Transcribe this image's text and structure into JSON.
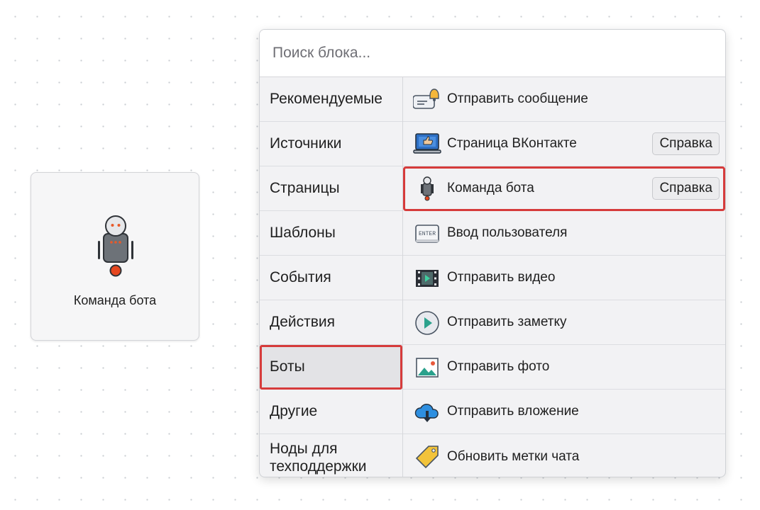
{
  "canvas_node": {
    "label": "Команда бота",
    "icon": "robot-icon"
  },
  "search": {
    "placeholder": "Поиск блока..."
  },
  "categories": [
    {
      "label": "Рекомендуемые"
    },
    {
      "label": "Источники"
    },
    {
      "label": "Страницы"
    },
    {
      "label": "Шаблоны"
    },
    {
      "label": "События"
    },
    {
      "label": "Действия"
    },
    {
      "label": "Боты",
      "selected": true
    },
    {
      "label": "Другие"
    },
    {
      "label": "Ноды для техподдержки"
    }
  ],
  "blocks": [
    {
      "label": "Отправить сообщение",
      "icon": "message-bell-icon"
    },
    {
      "label": "Страница ВКонтакте",
      "icon": "laptop-like-icon",
      "help": "Справка"
    },
    {
      "label": "Команда бота",
      "icon": "robot-icon",
      "help": "Справка",
      "highlighted": true
    },
    {
      "label": "Ввод пользователя",
      "icon": "enter-key-icon"
    },
    {
      "label": "Отправить видео",
      "icon": "film-strip-icon"
    },
    {
      "label": "Отправить заметку",
      "icon": "play-circle-icon"
    },
    {
      "label": "Отправить фото",
      "icon": "image-icon"
    },
    {
      "label": "Отправить вложение",
      "icon": "cloud-download-icon"
    },
    {
      "label": "Обновить метки чата",
      "icon": "tag-icon"
    }
  ],
  "colors": {
    "highlight": "#d63b3b",
    "panel_bg": "#f2f2f4",
    "selected_bg": "#e3e3e6"
  }
}
